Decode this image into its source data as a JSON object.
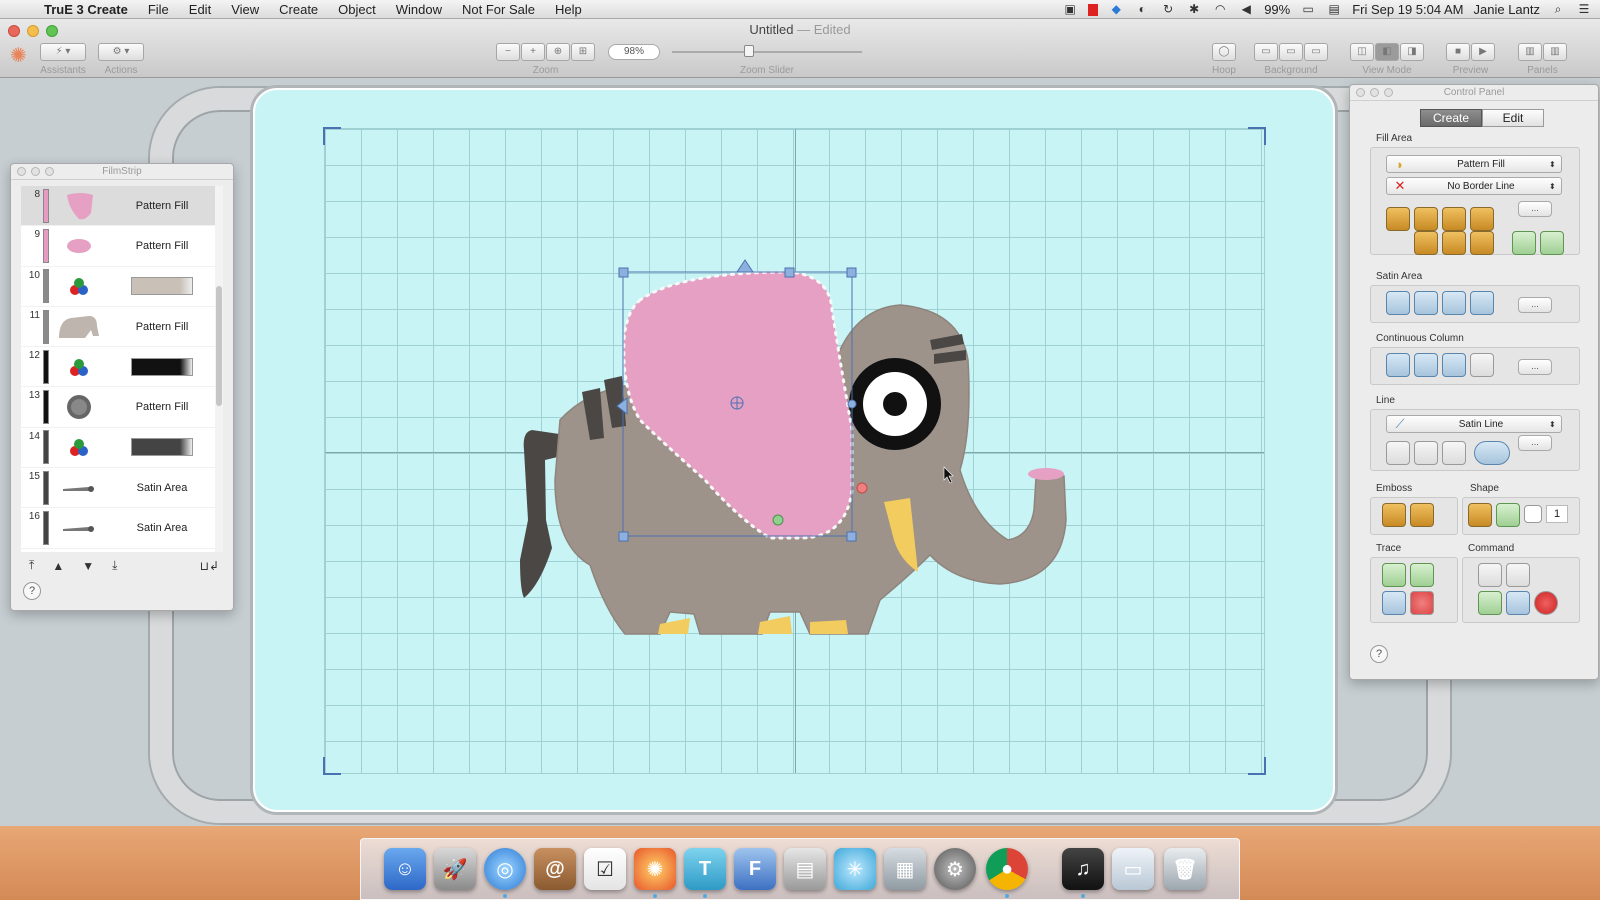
{
  "menubar": {
    "app_name": "TruE 3 Create",
    "items": [
      "File",
      "Edit",
      "View",
      "Create",
      "Object",
      "Window",
      "Not For Sale",
      "Help"
    ],
    "battery": "99%",
    "datetime": "Fri Sep 19  5:04 AM",
    "user": "Janie Lantz"
  },
  "window": {
    "title": "Untitled",
    "title_status": "— Edited"
  },
  "toolbar": {
    "assistants": "Assistants",
    "actions": "Actions",
    "zoom": "Zoom",
    "zoom_value": "98%",
    "zoom_slider": "Zoom Slider",
    "zoom_level": 0.4,
    "hoop": "Hoop",
    "background": "Background",
    "view_mode": "View Mode",
    "preview": "Preview",
    "panels": "Panels"
  },
  "filmstrip": {
    "title": "FilmStrip",
    "rows": [
      {
        "num": "8",
        "label": "Pattern Fill",
        "type": "pattern",
        "thumb": "pink-ear",
        "bar_color": "#e79bc0",
        "selected": true
      },
      {
        "num": "9",
        "label": "Pattern Fill",
        "type": "pattern",
        "thumb": "pink-small",
        "bar_color": "#e79bc0",
        "selected": false
      },
      {
        "num": "10",
        "label": "",
        "type": "color",
        "thumb": "color-icon",
        "swatch": "#c9c0b8",
        "bar_color": "#8a8a8a",
        "selected": false
      },
      {
        "num": "11",
        "label": "Pattern Fill",
        "type": "pattern",
        "thumb": "elephant-body",
        "bar_color": "#8a8a8a",
        "selected": false
      },
      {
        "num": "12",
        "label": "",
        "type": "color",
        "thumb": "color-icon",
        "swatch": "#111111",
        "bar_color": "#111111",
        "selected": false
      },
      {
        "num": "13",
        "label": "Pattern Fill",
        "type": "pattern",
        "thumb": "eye-disc",
        "bar_color": "#111111",
        "selected": false
      },
      {
        "num": "14",
        "label": "",
        "type": "color",
        "thumb": "color-icon",
        "swatch": "#444444",
        "bar_color": "#444444",
        "selected": false
      },
      {
        "num": "15",
        "label": "Satin Area",
        "type": "satin",
        "thumb": "satin",
        "bar_color": "#444444",
        "selected": false
      },
      {
        "num": "16",
        "label": "Satin Area",
        "type": "satin",
        "thumb": "satin",
        "bar_color": "#444444",
        "selected": false
      }
    ],
    "help": "?"
  },
  "control_panel": {
    "title": "Control Panel",
    "tabs": [
      "Create",
      "Edit"
    ],
    "active_tab": "Create",
    "fill_area": "Fill Area",
    "fill_select": "Pattern Fill",
    "border_select": "No Border Line",
    "satin_area": "Satin Area",
    "continuous_column": "Continuous Column",
    "line": "Line",
    "line_select": "Satin Line",
    "emboss": "Emboss",
    "shape": "Shape",
    "shape_count": "1",
    "trace": "Trace",
    "command": "Command",
    "more": "...",
    "help": "?"
  },
  "colors": {
    "ear_pink": "#e6a0c4",
    "body_gray": "#9e938a",
    "tusk_yellow": "#f2cc5e",
    "hoop_bg": "#c8f4f6",
    "grid_line": "#9fd0d4",
    "selection_blue": "#4a72b0"
  },
  "dock": {
    "icons": [
      "finder-icon",
      "launchpad-icon",
      "safari-icon",
      "contacts-icon",
      "reminders-icon",
      "embroidery-app-icon",
      "true3-create-icon",
      "quickfont-icon",
      "thread-icon",
      "stitch-icon",
      "machine-icon",
      "system-preferences-icon",
      "chrome-icon",
      "itunes-icon",
      "desktop-icon",
      "trash-icon"
    ]
  }
}
